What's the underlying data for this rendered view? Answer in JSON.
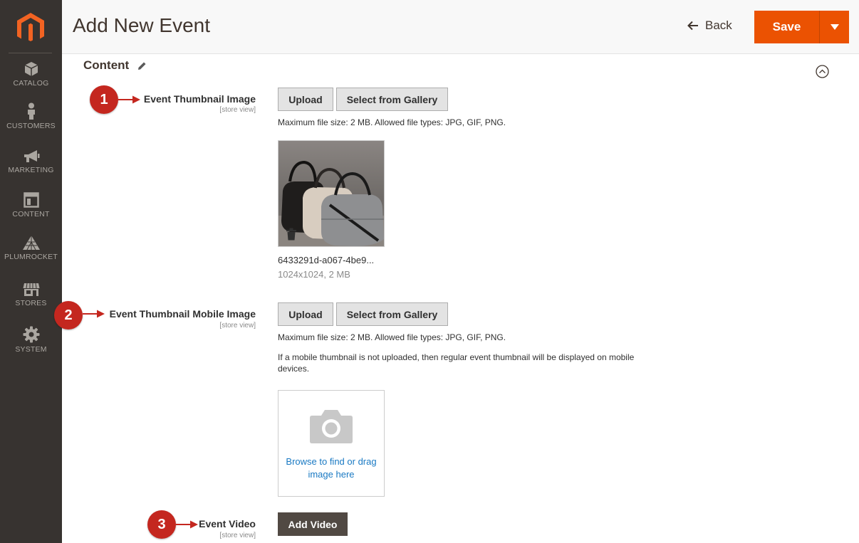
{
  "sidebar": {
    "items": [
      {
        "label": "CATALOG",
        "icon": "box-icon"
      },
      {
        "label": "CUSTOMERS",
        "icon": "person-icon"
      },
      {
        "label": "MARKETING",
        "icon": "megaphone-icon"
      },
      {
        "label": "CONTENT",
        "icon": "layout-icon"
      },
      {
        "label": "PLUMROCKET",
        "icon": "pyramid-icon"
      },
      {
        "label": "STORES",
        "icon": "storefront-icon"
      },
      {
        "label": "SYSTEM",
        "icon": "gear-icon"
      }
    ]
  },
  "header": {
    "title": "Add New Event",
    "back_label": "Back",
    "save_label": "Save"
  },
  "section": {
    "title": "Content"
  },
  "fields": {
    "thumbnail": {
      "label": "Event Thumbnail Image",
      "scope": "[store view]",
      "upload_label": "Upload",
      "gallery_label": "Select from Gallery",
      "note": "Maximum file size: 2 MB. Allowed file types: JPG, GIF, PNG.",
      "file_name": "6433291d-a067-4be9...",
      "file_meta": "1024x1024, 2 MB"
    },
    "mobile": {
      "label": "Event Thumbnail Mobile Image",
      "scope": "[store view]",
      "upload_label": "Upload",
      "gallery_label": "Select from Gallery",
      "note": "Maximum file size: 2 MB. Allowed file types: JPG, GIF, PNG.",
      "note2": "If a mobile thumbnail is not uploaded, then regular event thumbnail will be displayed on mobile devices.",
      "drop_text": "Browse to find or drag image here"
    },
    "video": {
      "label": "Event Video",
      "scope": "[store view]",
      "add_label": "Add Video"
    }
  },
  "callouts": [
    "1",
    "2",
    "3"
  ],
  "colors": {
    "sidebar_bg": "#373330",
    "accent": "#eb5202",
    "callout": "#c4271f",
    "link": "#1979c3"
  }
}
